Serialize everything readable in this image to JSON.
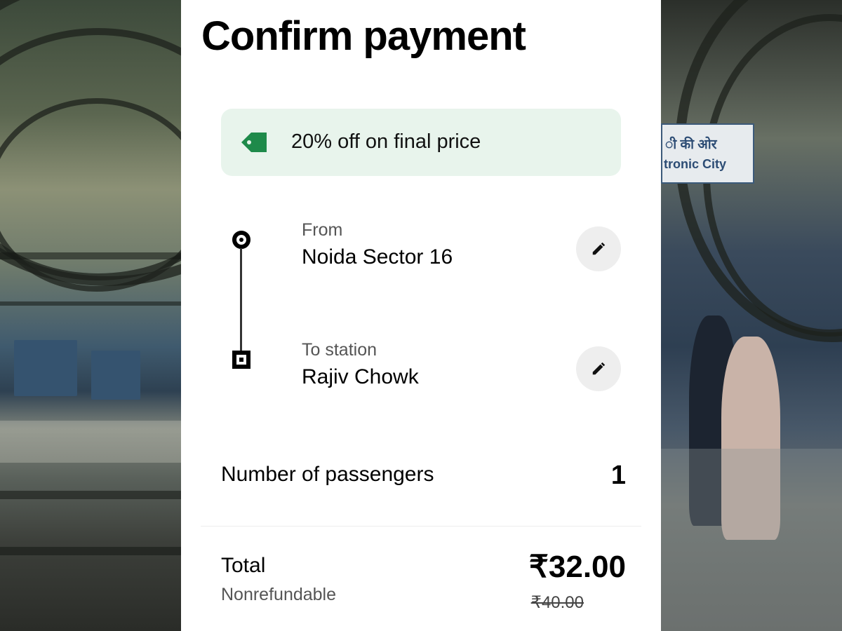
{
  "page": {
    "title": "Confirm payment"
  },
  "promo": {
    "text": "20% off on final price",
    "icon": "tag-icon",
    "color": "#1e8a4a",
    "background": "#e8f4ec"
  },
  "route": {
    "from": {
      "label": "From",
      "value": "Noida Sector 16",
      "edit_icon": "pencil-icon"
    },
    "to": {
      "label": "To station",
      "value": "Rajiv Chowk",
      "edit_icon": "pencil-icon"
    }
  },
  "passengers": {
    "label": "Number of passengers",
    "value": "1"
  },
  "total": {
    "label": "Total",
    "subtitle": "Nonrefundable",
    "price": "₹32.00",
    "original_price": "₹40.00"
  },
  "background_sign": {
    "line1": "ी की ओर",
    "line2": "tronic City"
  }
}
